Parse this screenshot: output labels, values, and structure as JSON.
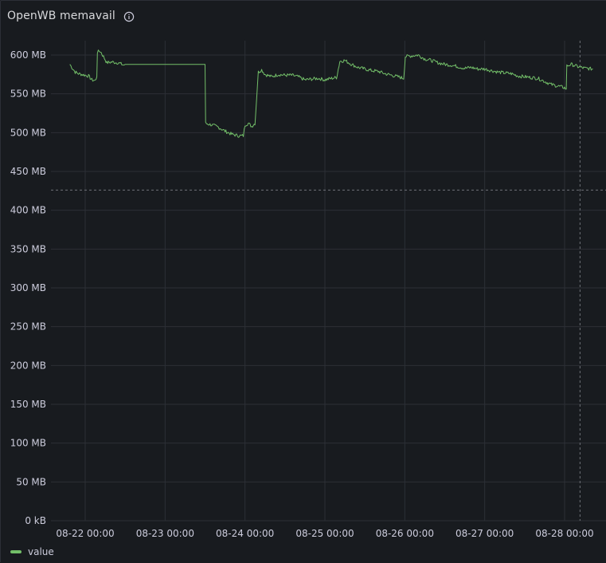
{
  "panel": {
    "title": "OpenWB memavail"
  },
  "icons": {
    "info": "info-circle-icon"
  },
  "colors": {
    "series": "#73bf69",
    "grid": "#2c2f36",
    "background": "#181b1f",
    "threshold": "#6e7178"
  },
  "chart_data": {
    "type": "line",
    "title": "OpenWB memavail",
    "xlabel": "",
    "ylabel": "",
    "ylim": [
      0,
      600
    ],
    "y_ticks": [
      "0 kB",
      "50 MB",
      "100 MB",
      "150 MB",
      "200 MB",
      "250 MB",
      "300 MB",
      "350 MB",
      "400 MB",
      "450 MB",
      "500 MB",
      "550 MB",
      "600 MB"
    ],
    "y_tick_values": [
      0,
      50,
      100,
      150,
      200,
      250,
      300,
      350,
      400,
      450,
      500,
      550,
      600
    ],
    "x_range": [
      "08-21 19:23",
      "08-28 08:30"
    ],
    "x_ticks": [
      "08-22 00:00",
      "08-23 00:00",
      "08-24 00:00",
      "08-25 00:00",
      "08-26 00:00",
      "08-27 00:00",
      "08-28 00:00"
    ],
    "x_tick_values": [
      "2024-08-22 00:00",
      "2024-08-23 00:00",
      "2024-08-24 00:00",
      "2024-08-25 00:00",
      "2024-08-26 00:00",
      "2024-08-27 00:00",
      "2024-08-28 00:00"
    ],
    "grid": true,
    "legend": "bottom-left",
    "threshold_y": 426,
    "threshold_x": "08-28 04:38",
    "series": [
      {
        "name": "value",
        "points": [
          [
            "08-21 19:23",
            588
          ],
          [
            "08-21 20:00",
            584
          ],
          [
            "08-21 21:00",
            578
          ],
          [
            "08-21 22:00",
            576
          ],
          [
            "08-21 23:00",
            575
          ],
          [
            "08-22 00:00",
            574
          ],
          [
            "08-22 01:00",
            573
          ],
          [
            "08-22 02:00",
            568
          ],
          [
            "08-22 03:00",
            567
          ],
          [
            "08-22 03:30",
            572
          ],
          [
            "08-22 03:40",
            604
          ],
          [
            "08-22 04:30",
            605
          ],
          [
            "08-22 05:30",
            598
          ],
          [
            "08-22 06:30",
            590
          ],
          [
            "08-22 08:00",
            591
          ],
          [
            "08-22 10:00",
            590
          ],
          [
            "08-22 11:30",
            587
          ],
          [
            "08-22 12:00",
            588
          ],
          [
            "08-23 12:00",
            588
          ],
          [
            "08-23 12:10",
            512
          ],
          [
            "08-23 14:00",
            510
          ],
          [
            "08-23 16:00",
            507
          ],
          [
            "08-23 18:00",
            502
          ],
          [
            "08-23 20:00",
            498
          ],
          [
            "08-23 22:00",
            496
          ],
          [
            "08-23 23:30",
            496
          ],
          [
            "08-24 00:00",
            510
          ],
          [
            "08-24 01:00",
            512
          ],
          [
            "08-24 02:00",
            508
          ],
          [
            "08-24 03:00",
            512
          ],
          [
            "08-24 04:00",
            578
          ],
          [
            "08-24 05:00",
            581
          ],
          [
            "08-24 06:00",
            575
          ],
          [
            "08-24 08:00",
            572
          ],
          [
            "08-24 10:00",
            575
          ],
          [
            "08-24 12:00",
            574
          ],
          [
            "08-24 14:00",
            574
          ],
          [
            "08-24 16:00",
            572
          ],
          [
            "08-24 18:00",
            568
          ],
          [
            "08-24 20:00",
            569
          ],
          [
            "08-24 22:00",
            570
          ],
          [
            "08-25 00:00",
            568
          ],
          [
            "08-25 02:00",
            570
          ],
          [
            "08-25 03:30",
            571
          ],
          [
            "08-25 04:30",
            592
          ],
          [
            "08-25 06:00",
            593
          ],
          [
            "08-25 08:00",
            588
          ],
          [
            "08-25 10:00",
            584
          ],
          [
            "08-25 12:00",
            582
          ],
          [
            "08-25 14:00",
            580
          ],
          [
            "08-25 16:00",
            579
          ],
          [
            "08-25 18:00",
            576
          ],
          [
            "08-25 20:00",
            574
          ],
          [
            "08-25 22:00",
            572
          ],
          [
            "08-25 23:40",
            570
          ],
          [
            "08-26 00:10",
            598
          ],
          [
            "08-26 02:00",
            599
          ],
          [
            "08-26 04:00",
            600
          ],
          [
            "08-26 06:00",
            595
          ],
          [
            "08-26 08:00",
            593
          ],
          [
            "08-26 10:00",
            590
          ],
          [
            "08-26 12:00",
            588
          ],
          [
            "08-26 14:00",
            587
          ],
          [
            "08-26 16:00",
            585
          ],
          [
            "08-26 18:00",
            583
          ],
          [
            "08-26 20:00",
            584
          ],
          [
            "08-26 22:00",
            582
          ],
          [
            "08-27 00:00",
            582
          ],
          [
            "08-27 02:00",
            580
          ],
          [
            "08-27 04:00",
            578
          ],
          [
            "08-27 06:00",
            577
          ],
          [
            "08-27 08:00",
            576
          ],
          [
            "08-27 10:00",
            573
          ],
          [
            "08-27 12:00",
            572
          ],
          [
            "08-27 14:00",
            571
          ],
          [
            "08-27 16:00",
            570
          ],
          [
            "08-27 18:00",
            566
          ],
          [
            "08-27 20:00",
            562
          ],
          [
            "08-27 22:00",
            560
          ],
          [
            "08-28 00:00",
            558
          ],
          [
            "08-28 00:30",
            556
          ],
          [
            "08-28 00:40",
            586
          ],
          [
            "08-28 02:00",
            588
          ],
          [
            "08-28 04:00",
            585
          ],
          [
            "08-28 06:00",
            583
          ],
          [
            "08-28 08:30",
            582
          ]
        ]
      }
    ]
  }
}
